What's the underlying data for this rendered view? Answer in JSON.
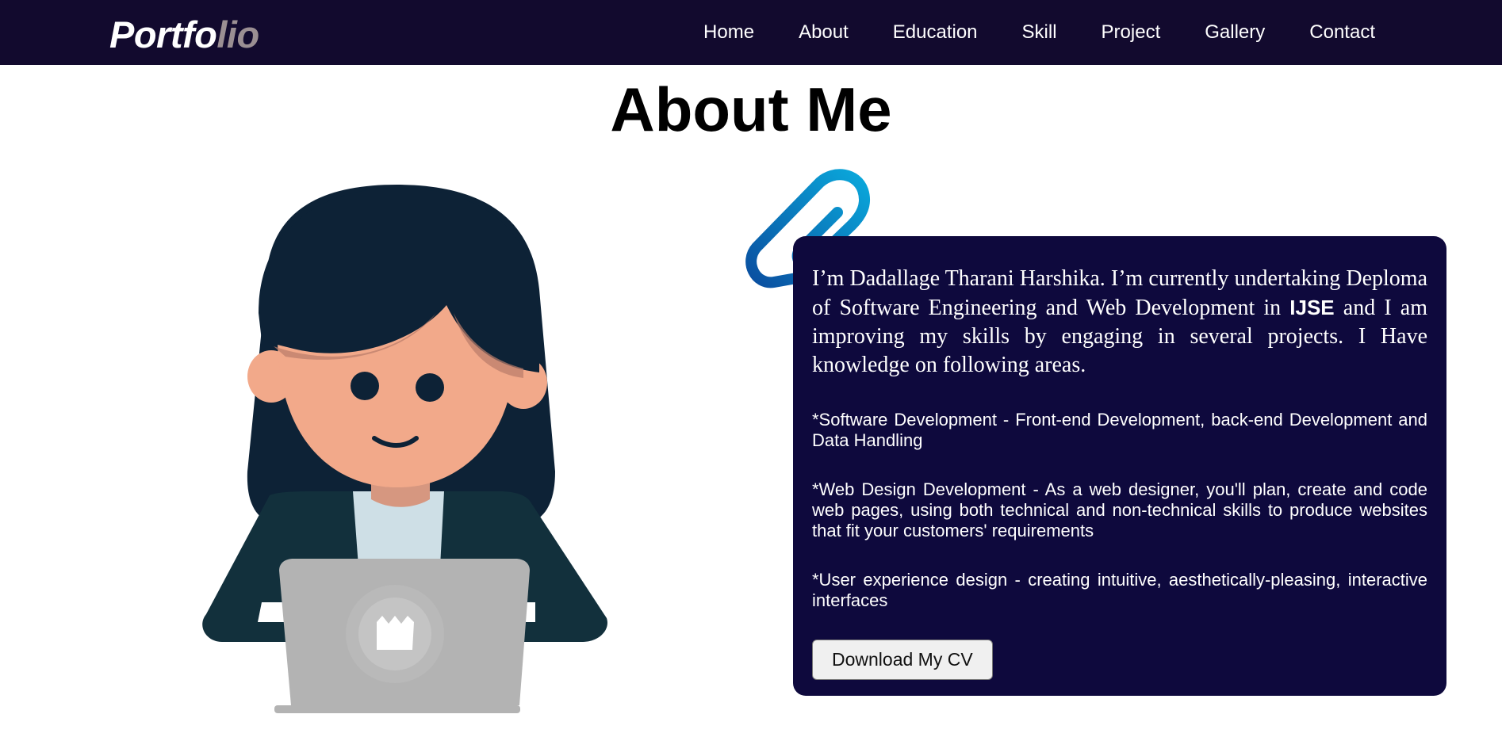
{
  "navbar": {
    "logo_main": "Portfo",
    "logo_accent": "lio",
    "links": [
      "Home",
      "About",
      "Education",
      "Skill",
      "Project",
      "Gallery",
      "Contact"
    ]
  },
  "page": {
    "title": "About Me"
  },
  "about": {
    "intro_before": "I’m Dadallage Tharani Harshika. I’m currently undertaking Deploma of Software Engineering and Web Development in ",
    "intro_strong": "IJSE",
    "intro_after": " and I am improving my skills by engaging in several projects. I Have knowledge on following areas.",
    "points": [
      "*Software Development - Front-end Development, back-end Development and Data Handling",
      "*Web Design Development - As a web designer, you'll plan, create and code web pages, using both technical and non-technical skills to produce websites that fit your customers' requirements",
      "*User experience design - creating intuitive, aesthetically-pleasing, interactive interfaces"
    ],
    "cv_button": "Download My CV"
  },
  "icons": {
    "paperclip": "paperclip-icon",
    "illustration": "woman-with-laptop-illustration"
  },
  "colors": {
    "navbar_bg": "#120a2e",
    "logo_accent": "#9b8f93",
    "card_bg": "#0e093d",
    "paperclip": "#0a8fce"
  }
}
